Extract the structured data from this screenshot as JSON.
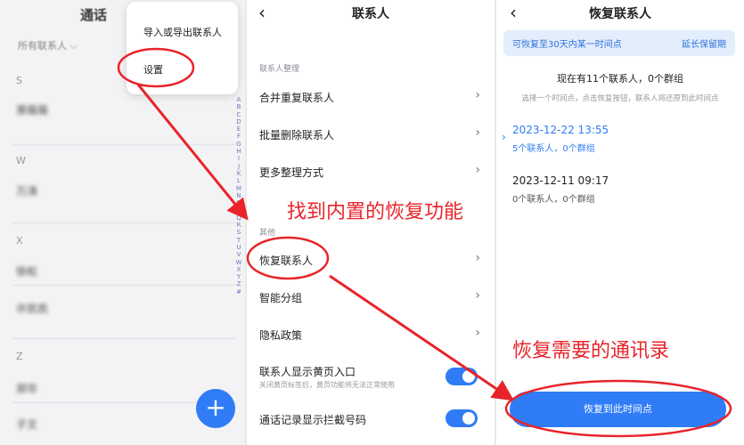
{
  "panel1": {
    "title": "通话",
    "filter": "所有联系人",
    "groups": [
      {
        "letter": "S",
        "contact": "萧薇薇"
      },
      {
        "letter": "W",
        "contact": "万涛"
      },
      {
        "letter": "X",
        "contacts": [
          "徐松",
          "许凯凯"
        ]
      },
      {
        "letter": "Z",
        "contacts": [
          "郑华",
          "子文"
        ]
      }
    ],
    "alphabet": [
      "A",
      "B",
      "C",
      "D",
      "E",
      "F",
      "G",
      "H",
      "I",
      "J",
      "K",
      "L",
      "M",
      "N",
      "O",
      "P",
      "Q",
      "R",
      "S",
      "T",
      "U",
      "V",
      "W",
      "X",
      "Y",
      "Z",
      "#"
    ],
    "menu": {
      "import_export": "导入或导出联系人",
      "settings": "设置"
    },
    "fab": "+"
  },
  "panel2": {
    "back": "‹",
    "title": "联系人",
    "section_organize": "联系人整理",
    "organize_items": [
      "合并重复联系人",
      "批量删除联系人",
      "更多整理方式"
    ],
    "section_other": "其他",
    "other_items": [
      "恢复联系人",
      "智能分组",
      "隐私政策"
    ],
    "yellow_page": {
      "label": "联系人显示黄页入口",
      "sub": "关闭黄页标签后，黄页功能将无法正常使用",
      "on": true
    },
    "intercept": {
      "label": "通话记录显示拦截号码",
      "on": true
    },
    "chevron": "›"
  },
  "panel3": {
    "back": "‹",
    "title": "恢复联系人",
    "banner_left": "可恢复至30天内某一时间点",
    "banner_right": "延长保留期",
    "current": "现在有11个联系人，0个群组",
    "hint": "选择一个时间点，点击恢复按钮，联系人将还原到此时间点",
    "timepoints": [
      {
        "date": "2023-12-22 13:55",
        "summary": "5个联系人，0个群组",
        "selected": true
      },
      {
        "date": "2023-12-11 09:17",
        "summary": "0个联系人，0个群组",
        "selected": false
      }
    ],
    "restore_button": "恢复到此时间点"
  },
  "annotations": {
    "find_builtin": "找到内置的恢复功能",
    "restore_needed": "恢复需要的通讯录"
  },
  "colors": {
    "accent": "#2f7cf6",
    "annotation": "#e8242a"
  }
}
